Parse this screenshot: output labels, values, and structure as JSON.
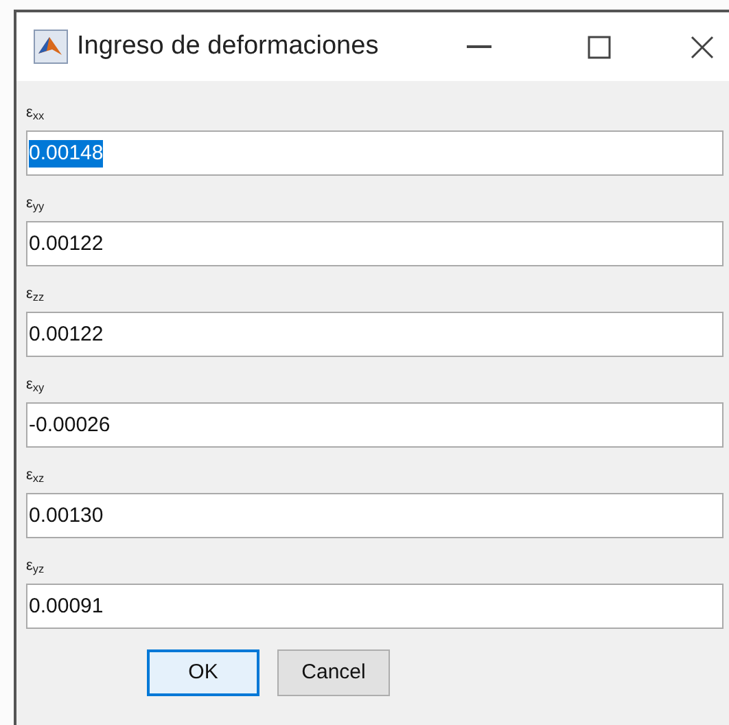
{
  "window": {
    "title": "Ingreso de deformaciones"
  },
  "fields": [
    {
      "label": "ε$_{xx}$",
      "value": "0.00148",
      "text_selected": true
    },
    {
      "label": "ε$_{yy}$",
      "value": "0.00122",
      "text_selected": false
    },
    {
      "label": "ε$_{zz}$",
      "value": "0.00122",
      "text_selected": false
    },
    {
      "label": "ε$_{xy}$",
      "value": "-0.00026",
      "text_selected": false
    },
    {
      "label": "ε$_{xz}$",
      "value": "0.00130",
      "text_selected": false
    },
    {
      "label": "ε$_{yz}$",
      "value": "0.00091",
      "text_selected": false
    }
  ],
  "buttons": [
    {
      "label": "OK",
      "focused": true
    },
    {
      "label": "Cancel",
      "focused": false
    }
  ]
}
